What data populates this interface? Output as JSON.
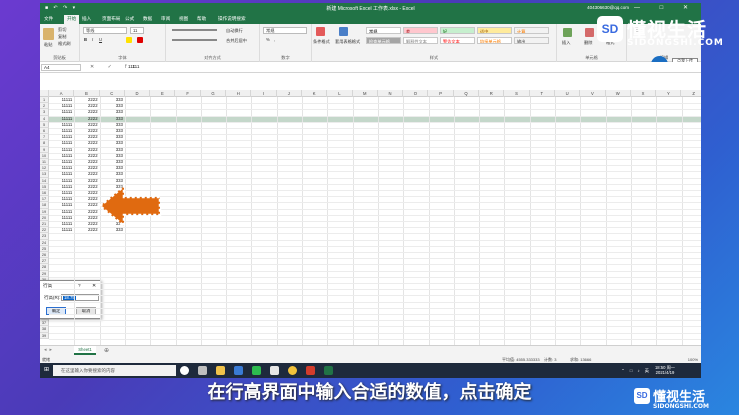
{
  "window": {
    "title": "新建 Microsoft Excel 工作表.xlsx - Excel",
    "account": "404306630@qq.com",
    "quick_access": "■ ↶ ↷ ▾",
    "controls": "— □ ✕"
  },
  "tabs": [
    "文件",
    "开始",
    "插入",
    "页面布局",
    "公式",
    "数据",
    "审阅",
    "视图",
    "帮助",
    "操作说明搜索"
  ],
  "active_tab": "开始",
  "ribbon": {
    "clipboard": {
      "label": "剪贴板",
      "paste": "粘贴",
      "cut": "剪切",
      "copy": "复制",
      "format_painter": "格式刷"
    },
    "font": {
      "label": "字体",
      "font_name": "等线",
      "font_size": "11",
      "bold": "B",
      "italic": "I",
      "underline": "U"
    },
    "alignment": {
      "label": "对齐方式",
      "wrap": "自动换行",
      "merge": "合并后居中"
    },
    "number": {
      "label": "数字",
      "format": "常规",
      "pct": "%",
      "comma": ","
    },
    "styles": {
      "label": "样式",
      "cond_format": "条件格式",
      "table_format": "套用表格格式",
      "items": [
        {
          "text": "常规",
          "bg": "#ffffff",
          "color": "#000000"
        },
        {
          "text": "差",
          "bg": "#ffc7ce",
          "color": "#9c0006"
        },
        {
          "text": "好",
          "bg": "#c6efce",
          "color": "#006100"
        },
        {
          "text": "适中",
          "bg": "#ffeb9c",
          "color": "#9c5700"
        },
        {
          "text": "计算",
          "bg": "#f2f2f2",
          "color": "#fa7d00"
        },
        {
          "text": "检查单元格",
          "bg": "#a5a5a5",
          "color": "#ffffff"
        },
        {
          "text": "解释性文本",
          "bg": "#ffffff",
          "color": "#7f7f7f"
        },
        {
          "text": "警告文本",
          "bg": "#ffffff",
          "color": "#ff0000"
        },
        {
          "text": "链接单元格",
          "bg": "#ffffff",
          "color": "#fa7d00"
        },
        {
          "text": "输出",
          "bg": "#f2f2f2",
          "color": "#3f3f3f"
        }
      ]
    },
    "cells": {
      "label": "单元格",
      "insert": "插入",
      "delete": "删除",
      "format": "格式"
    },
    "editing": {
      "label": "编辑"
    }
  },
  "formula_bar": {
    "name_box": "A4",
    "fx": "✕ ✓ fx",
    "value": "11111"
  },
  "columns": [
    "A",
    "B",
    "C",
    "D",
    "E",
    "F",
    "G",
    "H",
    "I",
    "J",
    "K",
    "L",
    "M",
    "N",
    "O",
    "P",
    "Q",
    "R",
    "S",
    "T",
    "U",
    "V",
    "W",
    "X",
    "Y",
    "Z"
  ],
  "rows": [
    "1",
    "2",
    "3",
    "4",
    "5",
    "6",
    "7",
    "8",
    "9",
    "10",
    "11",
    "12",
    "13",
    "14",
    "15",
    "16",
    "17",
    "18",
    "19",
    "20",
    "21",
    "22",
    "23",
    "24",
    "25",
    "26",
    "27",
    "28",
    "29",
    "30",
    "31",
    "32",
    "33",
    "34",
    "35",
    "36",
    "37",
    "38",
    "39"
  ],
  "data_rows": [
    [
      "11111",
      "2222",
      "333"
    ],
    [
      "11111",
      "2222",
      "333"
    ],
    [
      "11111",
      "2222",
      "333"
    ],
    [
      "11111",
      "2222",
      "333"
    ],
    [
      "11111",
      "2222",
      "333"
    ],
    [
      "11111",
      "2222",
      "333"
    ],
    [
      "11111",
      "2222",
      "333"
    ],
    [
      "11111",
      "2222",
      "333"
    ],
    [
      "11111",
      "2222",
      "333"
    ],
    [
      "11111",
      "2222",
      "333"
    ],
    [
      "11111",
      "2222",
      "333"
    ],
    [
      "11111",
      "2222",
      "333"
    ],
    [
      "11111",
      "2222",
      "333"
    ],
    [
      "11111",
      "2222",
      "333"
    ],
    [
      "11111",
      "2222",
      "333"
    ],
    [
      "11111",
      "2222",
      "333"
    ],
    [
      "11111",
      "2222",
      "333"
    ],
    [
      "11111",
      "2222",
      "333"
    ],
    [
      "11111",
      "2222",
      "333"
    ],
    [
      "11111",
      "2222",
      "333"
    ],
    [
      "11111",
      "2222",
      "333"
    ],
    [
      "11111",
      "2222",
      "333"
    ]
  ],
  "selected_row": 4,
  "dialog": {
    "title": "行高",
    "help": "?",
    "close": "✕",
    "label": "行高(R):",
    "value": "18.75",
    "ok": "确定",
    "cancel": "取消"
  },
  "sheet_tab": "Sheet1",
  "add_sheet": "⊕",
  "status": {
    "ready": "就绪",
    "average": "平均值: 4555.333333",
    "count": "计数: 3",
    "sum": "求和: 13666",
    "zoom": "100%"
  },
  "taskbar": {
    "start": "⊞",
    "search_placeholder": "在这里输入你要搜索的内容",
    "time": "18:50 周一",
    "date": "2021/4/19",
    "tray": "⌃ □ ♪ 英"
  },
  "share": {
    "counter": "0044",
    "label": "点我上传"
  },
  "logo": {
    "mark": "SD",
    "brand": "懂视生活",
    "url": "SIDONGSHI.COM"
  },
  "logo_small": {
    "mark": "SD",
    "brand": "懂视生活",
    "url": "SIDONGSHI.COM"
  },
  "caption": "在行高界面中输入合适的数值，点击确定",
  "colors": {
    "excel_green": "#217346",
    "arrow_orange": "#e06a10",
    "selection": "#93b69f"
  }
}
